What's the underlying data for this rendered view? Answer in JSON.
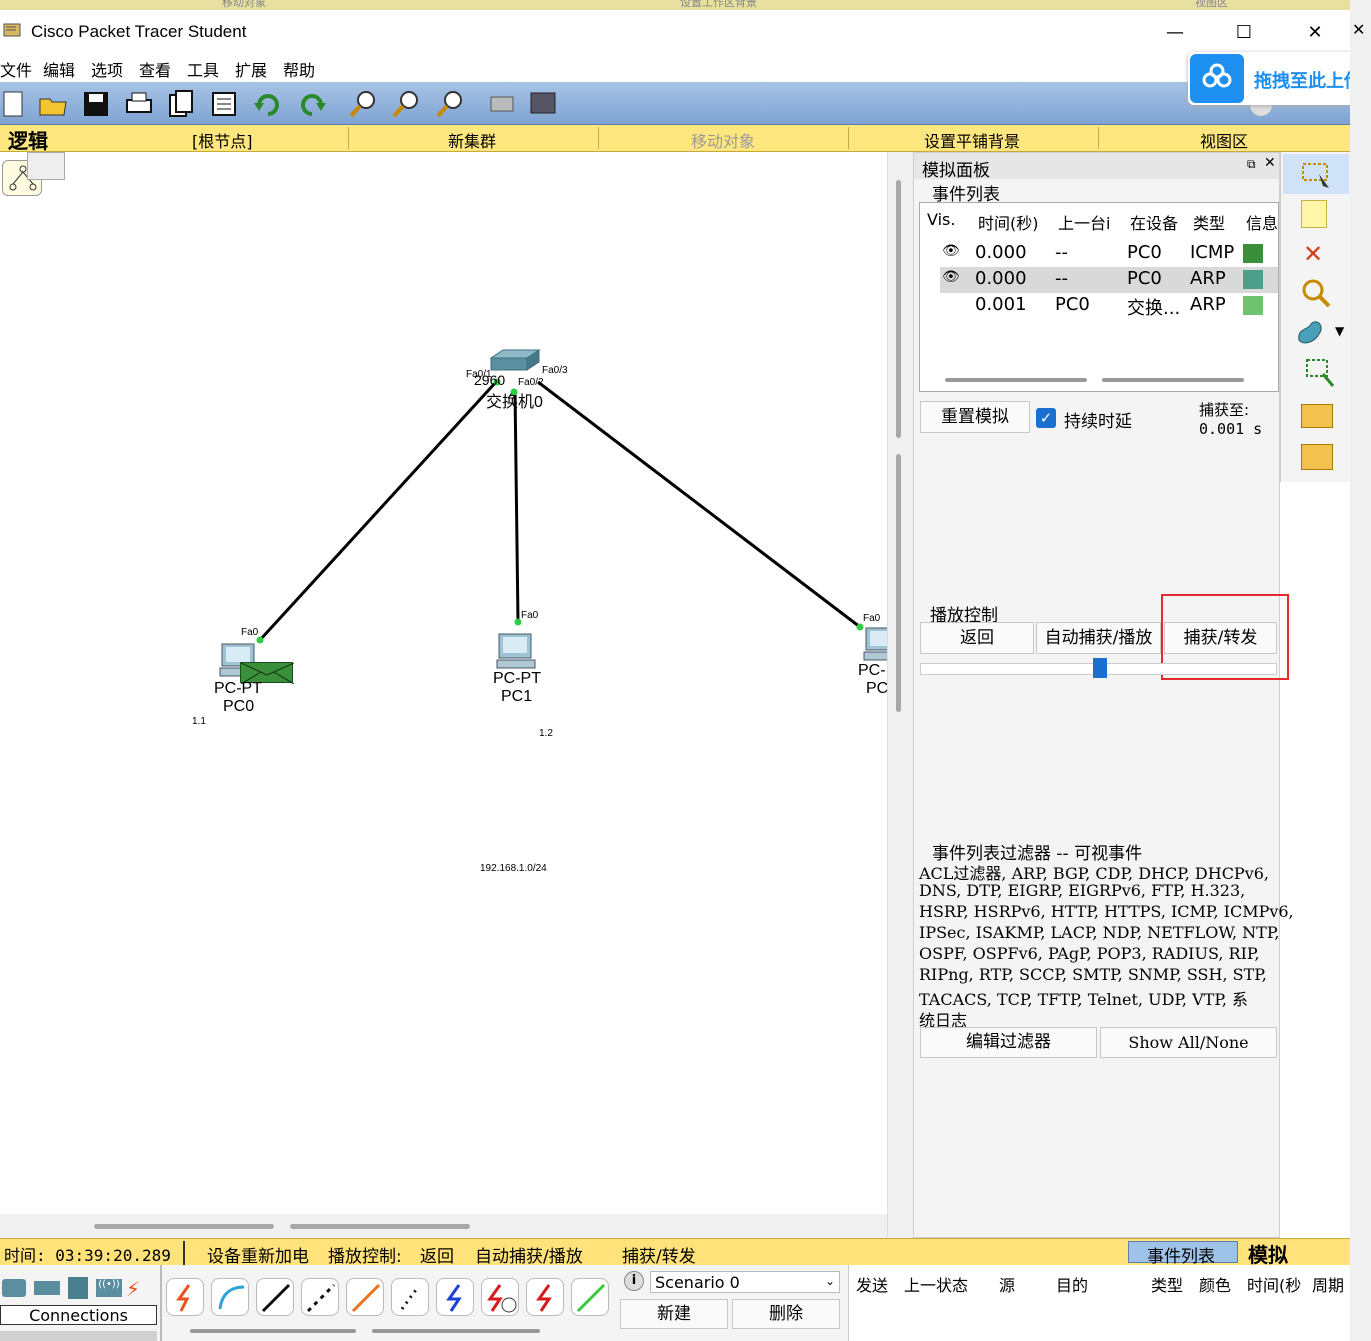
{
  "window": {
    "title": "Cisco Packet Tracer Student",
    "minimize": "—",
    "maximize": "☐",
    "close": "✕"
  },
  "top_strip": {
    "labels": [
      "移动对象",
      "设置工作区背景",
      "视图区"
    ]
  },
  "menu": {
    "items": [
      "文件",
      "编辑",
      "选项",
      "查看",
      "工具",
      "扩展",
      "帮助"
    ]
  },
  "cloud_upload": {
    "label": "拖拽至此上传"
  },
  "logic_bar": {
    "mode": "逻辑",
    "root": "[根节点]",
    "new_cluster": "新集群",
    "move_object": "移动对象",
    "set_tiled_bg": "设置平铺背景",
    "viewport": "视图区"
  },
  "topology": {
    "switch": {
      "model": "2960",
      "name": "交换机0",
      "port1": "Fa0/1",
      "port2": "Fa0/2",
      "port3": "Fa0/3"
    },
    "pc0": {
      "type": "PC-PT",
      "name": "PC0",
      "port": "Fa0",
      "ip_note": "1.1"
    },
    "pc1": {
      "type": "PC-PT",
      "name": "PC1",
      "port": "Fa0",
      "ip_note": "1.2"
    },
    "pc2": {
      "type": "PC-",
      "name": "PC",
      "port": "Fa0"
    },
    "network_note": "192.168.1.0/24"
  },
  "sim_panel": {
    "title": "模拟面板",
    "event_list_label": "事件列表",
    "columns": [
      "Vis.",
      "时间(秒)",
      "上一台i",
      "在设备",
      "类型",
      "信息"
    ],
    "events": [
      {
        "time": "0.000",
        "last": "--",
        "at": "PC0",
        "type": "ICMP",
        "color": "#3a8f3a"
      },
      {
        "time": "0.000",
        "last": "--",
        "at": "PC0",
        "type": "ARP",
        "color": "#4aa088"
      },
      {
        "time": "0.001",
        "last": "PC0",
        "at": "交换...",
        "type": "ARP",
        "color": "#6ec46e"
      }
    ],
    "reset_btn": "重置模拟",
    "constant_delay": "持续时延",
    "captured_to_label": "捕获至:",
    "captured_to_value": "0.001 s",
    "play_controls_label": "播放控制",
    "back_btn": "返回",
    "auto_capture_btn": "自动捕获/播放",
    "capture_forward_btn": "捕获/转发",
    "filter_title": "事件列表过滤器 -- 可视事件",
    "filter_lines": [
      "ACL过滤器, ARP, BGP, CDP, DHCP, DHCPv6,",
      "DNS, DTP, EIGRP, EIGRPv6, FTP, H.323,",
      "HSRP, HSRPv6, HTTP, HTTPS, ICMP, ICMPv6,",
      "IPSec, ISAKMP, LACP, NDP, NETFLOW, NTP,",
      "OSPF, OSPFv6, PAgP, POP3, RADIUS, RIP,",
      "RIPng, RTP, SCCP, SMTP, SNMP, SSH, STP,",
      "TACACS, TCP, TFTP, Telnet, UDP, VTP, 系",
      "统日志"
    ],
    "edit_filter_btn": "编辑过滤器",
    "show_all_btn": "Show All/None"
  },
  "status": {
    "time_label": "时间: 03:39:20.289",
    "power_cycle": "设备重新加电",
    "play_ctrl_label": "播放控制:",
    "back": "返回",
    "auto": "自动捕获/播放",
    "capture": "捕获/转发",
    "event_list_tab": "事件列表",
    "simulation_tab": "模拟"
  },
  "bottom": {
    "connections_label": "Connections",
    "scenario": "Scenario 0",
    "new_btn": "新建",
    "delete_btn": "删除",
    "pdu_columns": [
      "发送",
      "上一状态",
      "源",
      "目的",
      "类型",
      "颜色",
      "时间(秒",
      "周期"
    ]
  }
}
